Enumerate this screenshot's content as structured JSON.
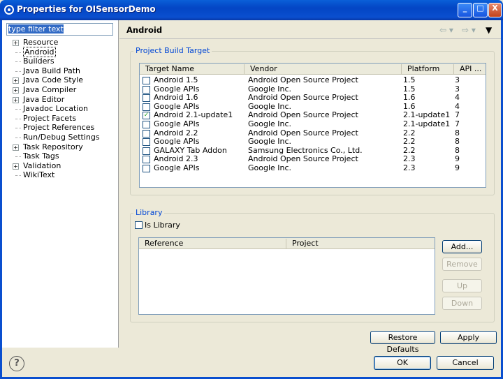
{
  "window": {
    "title": "Properties for OISensorDemo",
    "controls": [
      "_",
      "□",
      "X"
    ]
  },
  "filter": {
    "placeholder": "type filter text"
  },
  "tree": [
    {
      "label": "Resource",
      "expandable": true
    },
    {
      "label": "Android",
      "expandable": false,
      "selected": true
    },
    {
      "label": "Builders",
      "expandable": false
    },
    {
      "label": "Java Build Path",
      "expandable": false
    },
    {
      "label": "Java Code Style",
      "expandable": true
    },
    {
      "label": "Java Compiler",
      "expandable": true
    },
    {
      "label": "Java Editor",
      "expandable": true
    },
    {
      "label": "Javadoc Location",
      "expandable": false
    },
    {
      "label": "Project Facets",
      "expandable": false
    },
    {
      "label": "Project References",
      "expandable": false
    },
    {
      "label": "Run/Debug Settings",
      "expandable": false
    },
    {
      "label": "Task Repository",
      "expandable": true
    },
    {
      "label": "Task Tags",
      "expandable": false
    },
    {
      "label": "Validation",
      "expandable": true
    },
    {
      "label": "WikiText",
      "expandable": false
    }
  ],
  "page": {
    "title": "Android"
  },
  "build_target": {
    "group_label": "Project Build Target",
    "columns": [
      "Target Name",
      "Vendor",
      "Platform",
      "API ..."
    ],
    "rows": [
      {
        "name": "Android 1.5",
        "vendor": "Android Open Source Project",
        "platform": "1.5",
        "api": "3",
        "checked": false
      },
      {
        "name": "Google APIs",
        "vendor": "Google Inc.",
        "platform": "1.5",
        "api": "3",
        "checked": false
      },
      {
        "name": "Android 1.6",
        "vendor": "Android Open Source Project",
        "platform": "1.6",
        "api": "4",
        "checked": false
      },
      {
        "name": "Google APIs",
        "vendor": "Google Inc.",
        "platform": "1.6",
        "api": "4",
        "checked": false
      },
      {
        "name": "Android 2.1-update1",
        "vendor": "Android Open Source Project",
        "platform": "2.1-update1",
        "api": "7",
        "checked": true
      },
      {
        "name": "Google APIs",
        "vendor": "Google Inc.",
        "platform": "2.1-update1",
        "api": "7",
        "checked": false
      },
      {
        "name": "Android 2.2",
        "vendor": "Android Open Source Project",
        "platform": "2.2",
        "api": "8",
        "checked": false
      },
      {
        "name": "Google APIs",
        "vendor": "Google Inc.",
        "platform": "2.2",
        "api": "8",
        "checked": false
      },
      {
        "name": "GALAXY Tab Addon",
        "vendor": "Samsung Electronics Co., Ltd.",
        "platform": "2.2",
        "api": "8",
        "checked": false
      },
      {
        "name": "Android 2.3",
        "vendor": "Android Open Source Project",
        "platform": "2.3",
        "api": "9",
        "checked": false
      },
      {
        "name": "Google APIs",
        "vendor": "Google Inc.",
        "platform": "2.3",
        "api": "9",
        "checked": false
      }
    ]
  },
  "library": {
    "group_label": "Library",
    "is_library_label": "Is Library",
    "is_library_checked": false,
    "columns": [
      "Reference",
      "Project"
    ],
    "buttons": {
      "add": "Add...",
      "remove": "Remove",
      "up": "Up",
      "down": "Down"
    }
  },
  "actions": {
    "restore_defaults": "Restore Defaults",
    "apply": "Apply",
    "ok": "OK",
    "cancel": "Cancel",
    "help": "?"
  },
  "colors": {
    "titlebar": "#0345c4",
    "group_label": "#0046d5",
    "selection": "#316ac5"
  }
}
